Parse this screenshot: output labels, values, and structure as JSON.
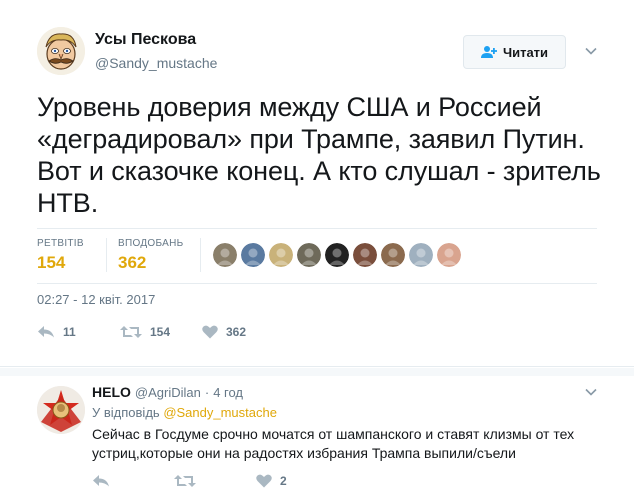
{
  "tweet": {
    "author_name": "Усы Пескова",
    "author_handle": "@Sandy_mustache",
    "follow_label": "Читати",
    "text": "Уровень доверия между США и Россией «деградировал» при Трампе, заявил Путин. Вот и сказочке конец. А кто слушал - зритель НТВ.",
    "retweets_label": "РЕТВІТІВ",
    "retweets_count": "154",
    "likes_label": "ВПОДОБАНЬ",
    "likes_count": "362",
    "timestamp": "02:27 - 12 квіт. 2017",
    "actions": {
      "replies": "11",
      "retweets": "154",
      "likes": "362"
    },
    "likers": [
      {
        "icon": "liker-avatar-1",
        "color": "#8a7f6a"
      },
      {
        "icon": "liker-avatar-2",
        "color": "#5a7aa0"
      },
      {
        "icon": "liker-avatar-3",
        "color": "#c9b27a"
      },
      {
        "icon": "liker-avatar-4",
        "color": "#6e6a5a"
      },
      {
        "icon": "liker-avatar-5",
        "color": "#222222"
      },
      {
        "icon": "liker-avatar-6",
        "color": "#7a4e3c"
      },
      {
        "icon": "liker-avatar-7",
        "color": "#8b6a4e"
      },
      {
        "icon": "liker-avatar-8",
        "color": "#9fb0bf"
      },
      {
        "icon": "liker-avatar-9",
        "color": "#d9a48f"
      }
    ]
  },
  "reply": {
    "author_name": "HELO",
    "author_handle": "@AgriDilan",
    "separator": "·",
    "time": "4 год",
    "reply_to_prefix": "У відповідь",
    "reply_to_mention": "@Sandy_mustache",
    "text": "Сейчас в Госдуме срочно мочатся от шампанского и ставят клизмы от тех устриц,которые они на радостях избрания Трампа выпили/съели",
    "actions": {
      "replies": "",
      "retweets": "",
      "likes": "2"
    }
  },
  "colors": {
    "accent": "#e0a80b",
    "muted": "#657786",
    "text": "#14171a",
    "border": "#e6ecf0"
  }
}
